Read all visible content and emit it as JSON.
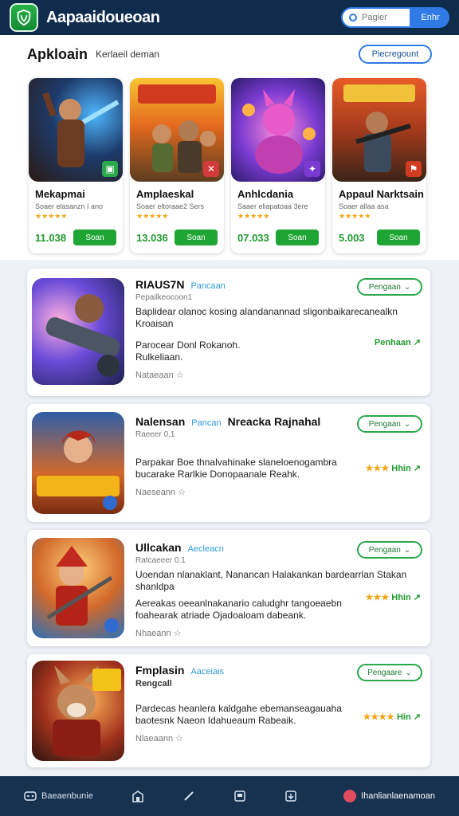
{
  "header": {
    "app_title": "Aapaaidoueoan",
    "search_placeholder": "Pagier",
    "search_button": "Enhr"
  },
  "section": {
    "title": "Apkloain",
    "subtitle": "Kerlaeil deman",
    "see_all": "Piecregount"
  },
  "featured": [
    {
      "name": "Mekapmai",
      "meta": "Soaer elasanzn I ano",
      "stars": "★★★★★",
      "price": "11.038",
      "button": "Soan"
    },
    {
      "name": "Amplaeskal",
      "meta": "Soaer eltoraae2 Sers",
      "stars": "★★★★★",
      "price": "13.036",
      "button": "Soan"
    },
    {
      "name": "Anhlcdania",
      "meta": "Saaer eliapatoaa 3ere",
      "stars": "★★★★★",
      "price": "07.033",
      "button": "Soan"
    },
    {
      "name": "Appaul Narktsain",
      "meta": "Soaer allaa asa",
      "stars": "★★★★★",
      "price": "5.003",
      "button": "Soan"
    }
  ],
  "apps": [
    {
      "title": "RIAUS7N",
      "tag": "Pancaan",
      "extra": "",
      "sub": "Pepailkeocoon1",
      "desc": "Baplidear olanoc kosing alandanannad sligonbaikarecanealkn Kroaisan",
      "desc2": "Parocear Donl Rokanoh. Rulkeliaan.",
      "note": "Nataeaan",
      "get": "Pengaan",
      "right_text": "Penhaan",
      "right_stars": ""
    },
    {
      "title": "Nalensan",
      "tag": "Pancan",
      "extra": "Nreacka Rajnahal",
      "sub": "Raeeer 0.1",
      "desc": "",
      "desc2": "Parpakar Boe thnalvahinake slaneloenogambra bucarake Rarlkie Donopaanale Reahk.",
      "note": "Naeseann",
      "get": "Pengaan",
      "right_text": "Hhin",
      "right_stars": "★★★"
    },
    {
      "title": "Ullcakan",
      "tag": "Aecleacn",
      "extra": "",
      "sub": "Ratcaeeer 0.1",
      "desc": "Uoendan nlanaklant, Nanancan Halakankan bardearrlan Stakan shanldpa",
      "desc2": "Aereakas oeeanlnakanario caludghr tangoeaebn foahearak atriade Ojadoaloam dabeank.",
      "note": "Nhaeann",
      "get": "Pengaan",
      "right_text": "Hhin",
      "right_stars": "★★★"
    },
    {
      "title": "Fmplasin",
      "tag": "Aaceiais",
      "extra": "",
      "sub": "Rengcall",
      "desc": "",
      "desc2": "Pardecas heanlera kaldgahe ebemanseagauaha baotesnk Naeon Idahueaum Rabeaik.",
      "note": "Nlaeaann",
      "get": "Pengaare",
      "right_text": "Hin",
      "right_stars": "★★★★"
    }
  ],
  "nav": {
    "home": "Baeaenbunie",
    "right": "Ihanlianlaenamoan"
  }
}
